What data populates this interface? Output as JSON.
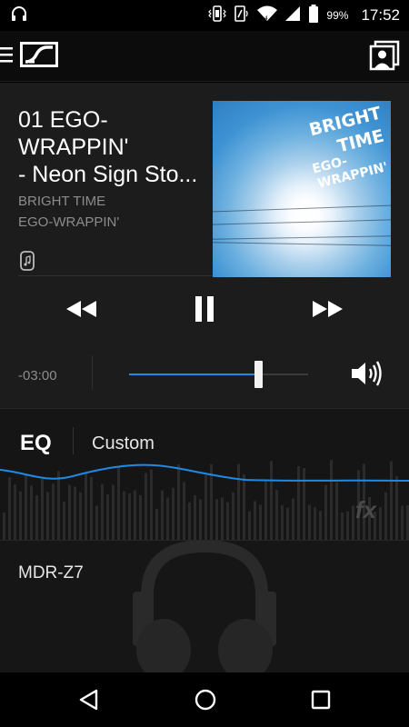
{
  "status_bar": {
    "battery_percent": "99%",
    "time": "17:52",
    "icons": [
      "headphones-icon",
      "vibrate-icon",
      "nfc-icon",
      "wifi-icon",
      "signal-icon",
      "battery-icon"
    ]
  },
  "app_bar": {
    "icons": [
      "menu-icon",
      "sennheiser-logo",
      "profile-icon"
    ]
  },
  "now_playing": {
    "title": "01 EGO-\nWRAPPIN'\n- Neon Sign Sto...",
    "album": "BRIGHT TIME",
    "artist": "EGO-WRAPPIN'",
    "album_art_text": {
      "line1": "BRIGHT",
      "line2": "TIME",
      "line3": "EGO-",
      "line4": "WRAPPIN'"
    },
    "time_remaining": "-03:00",
    "seek_position": 0.72,
    "state": "playing"
  },
  "eq": {
    "label": "EQ",
    "preset": "Custom",
    "fx_label": "fx",
    "accent_color": "#1e8ae6"
  },
  "device": {
    "name": "MDR-Z7"
  },
  "colors": {
    "accent": "#1e8ae6",
    "background": "#1c1c1c"
  }
}
